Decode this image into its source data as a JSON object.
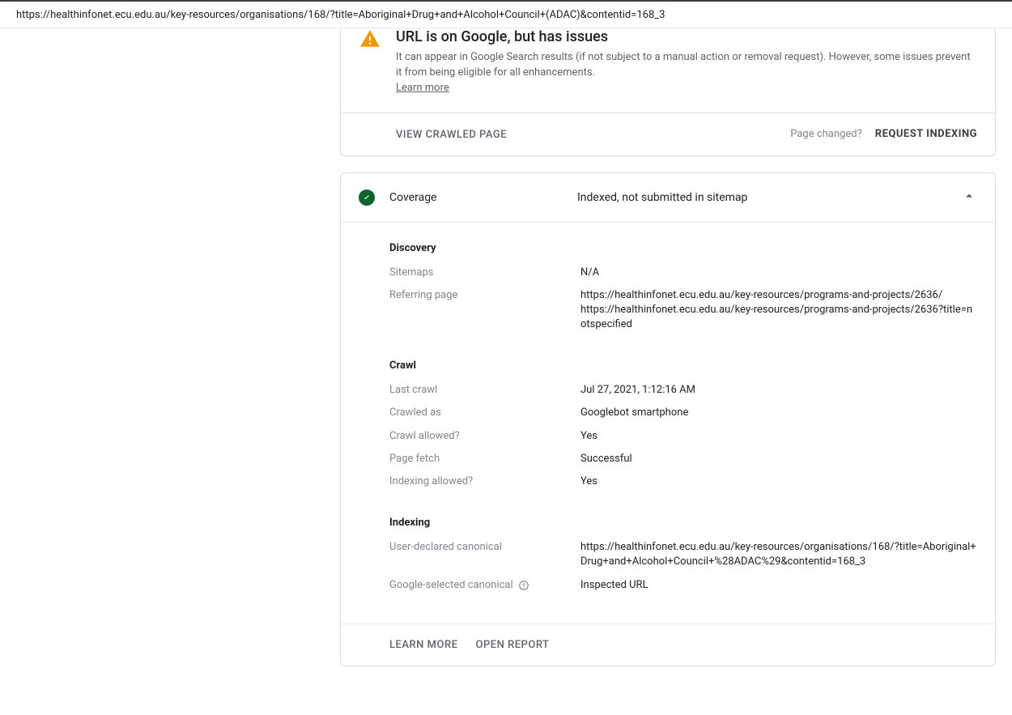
{
  "url_bar": {
    "url": "https://healthinfonet.ecu.edu.au/key-resources/organisations/168/?title=Aboriginal+Drug+and+Alcohol+Council+(ADAC)&contentid=168_3"
  },
  "status": {
    "title": "URL is on Google, but has issues",
    "description": "It can appear in Google Search results (if not subject to a manual action or removal request). However, some issues prevent it from being eligible for all enhancements.",
    "learn_more": "Learn more"
  },
  "actions": {
    "view_crawled": "VIEW CRAWLED PAGE",
    "page_changed": "Page changed?",
    "request_indexing": "REQUEST INDEXING"
  },
  "coverage": {
    "label": "Coverage",
    "value": "Indexed, not submitted in sitemap"
  },
  "discovery": {
    "heading": "Discovery",
    "sitemaps_label": "Sitemaps",
    "sitemaps_value": "N/A",
    "referring_label": "Referring page",
    "referring_value": "https://healthinfonet.ecu.edu.au/key-resources/programs-and-projects/2636/\nhttps://healthinfonet.ecu.edu.au/key-resources/programs-and-projects/2636?title=notspecified"
  },
  "crawl": {
    "heading": "Crawl",
    "last_crawl_label": "Last crawl",
    "last_crawl_value": "Jul 27, 2021, 1:12:16 AM",
    "crawled_as_label": "Crawled as",
    "crawled_as_value": "Googlebot smartphone",
    "crawl_allowed_label": "Crawl allowed?",
    "crawl_allowed_value": "Yes",
    "page_fetch_label": "Page fetch",
    "page_fetch_value": "Successful",
    "indexing_allowed_label": "Indexing allowed?",
    "indexing_allowed_value": "Yes"
  },
  "indexing": {
    "heading": "Indexing",
    "user_canonical_label": "User-declared canonical",
    "user_canonical_value": "https://healthinfonet.ecu.edu.au/key-resources/organisations/168/?title=Aboriginal+Drug+and+Alcohol+Council+%28ADAC%29&contentid=168_3",
    "google_canonical_label": "Google-selected canonical",
    "google_canonical_value": "Inspected URL"
  },
  "footer": {
    "learn_more": "LEARN MORE",
    "open_report": "OPEN REPORT"
  }
}
